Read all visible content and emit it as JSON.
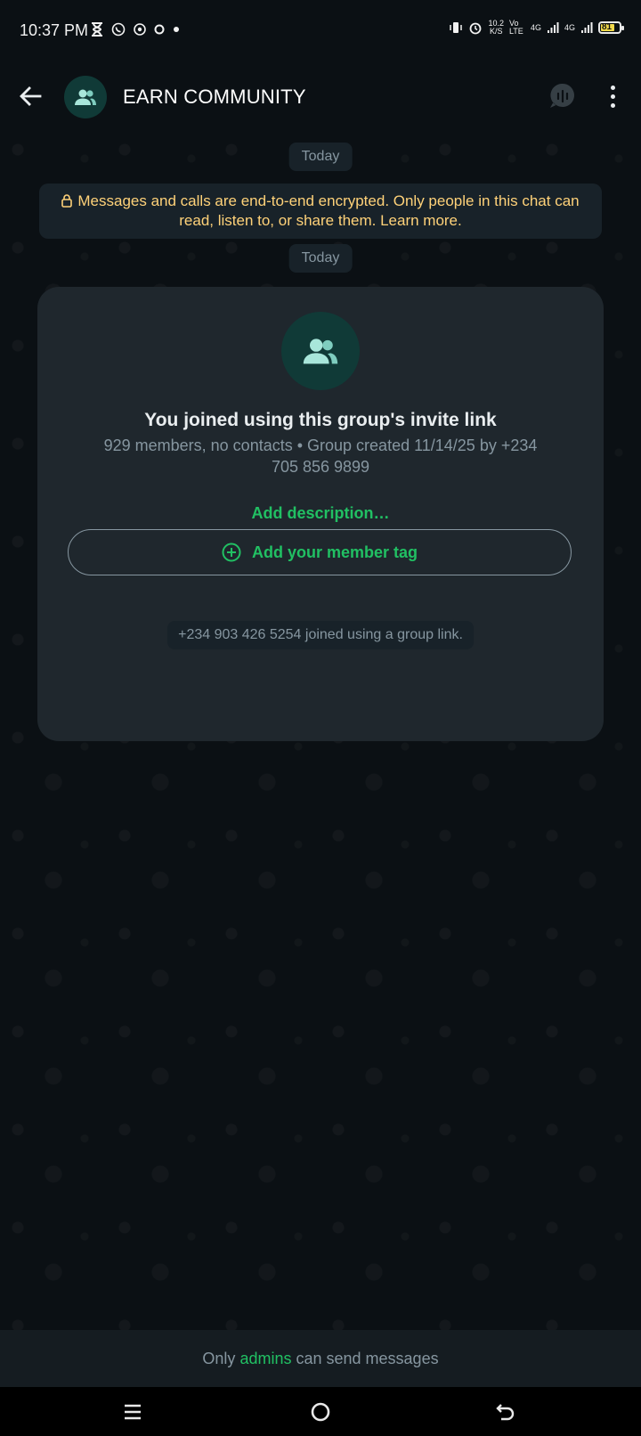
{
  "status_bar": {
    "time": "10:37 PM",
    "speed_value": "10.2",
    "speed_unit": "K/S",
    "volte": "Vo LTE",
    "net1": "4G",
    "net2": "4G",
    "battery": "81"
  },
  "header": {
    "title": "EARN COMMUNITY"
  },
  "chat": {
    "date_chip_1": "Today",
    "encryption_notice": "Messages and calls are end-to-end encrypted. Only people in this chat can read, listen to, or share them. Learn more.",
    "date_chip_2": "Today",
    "card": {
      "title": "You joined using this group's invite link",
      "subtitle": "929 members, no contacts • Group created 11/14/25 by +234 705 856 9899",
      "add_description": "Add description…",
      "member_tag_button": "Add your member tag"
    },
    "system_message": "+234 903 426 5254 joined using a group link."
  },
  "footer": {
    "prefix": "Only",
    "link": "admins",
    "suffix": "can send messages"
  },
  "colors": {
    "background": "#0b1014",
    "accent": "#21c063",
    "encryption_text": "#ffd279",
    "card_bg": "#1f272d"
  }
}
